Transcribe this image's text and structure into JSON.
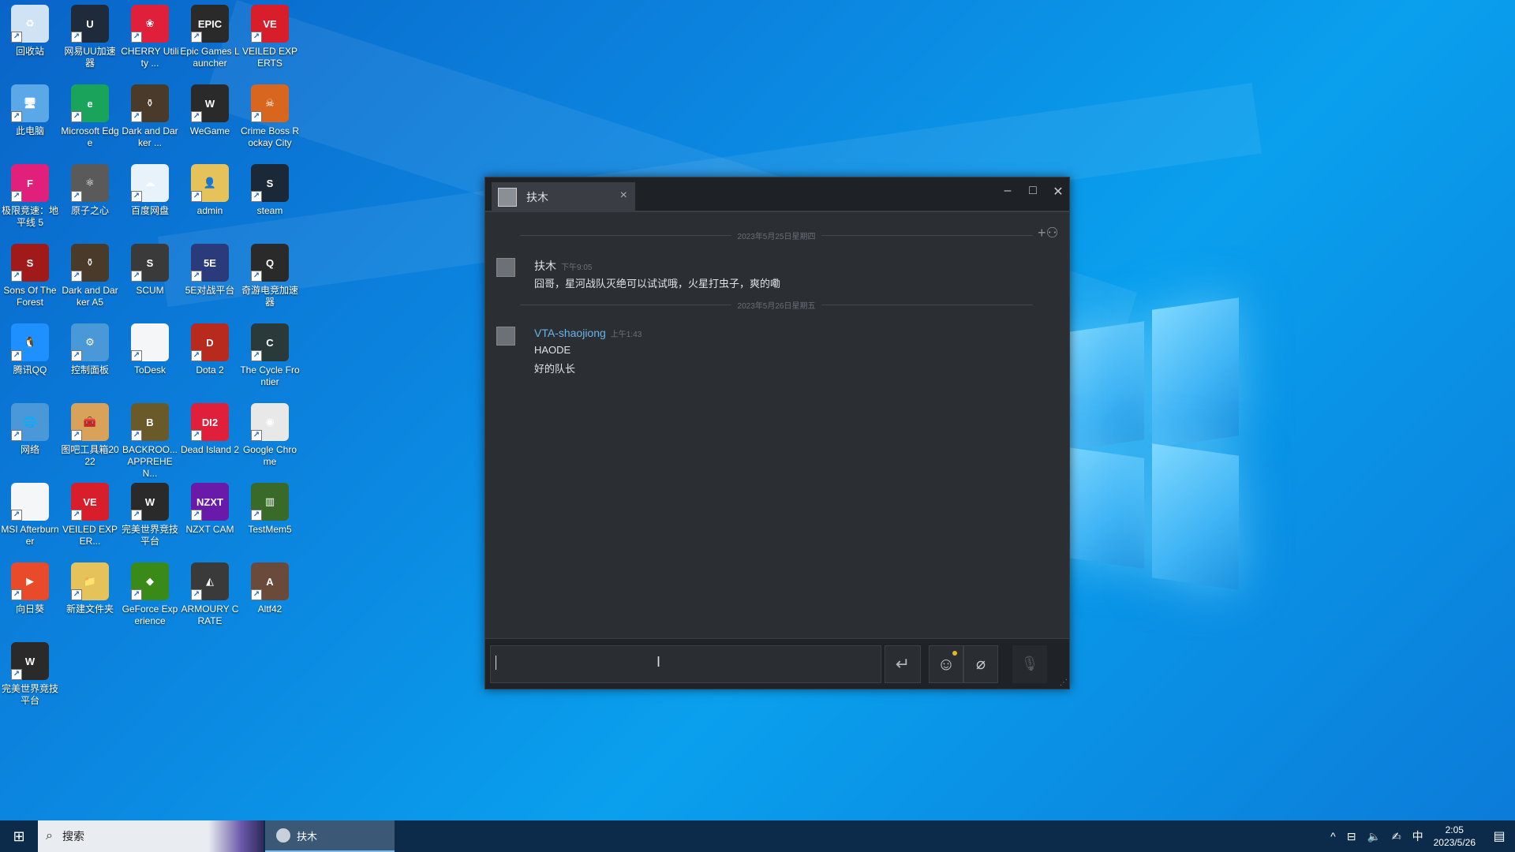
{
  "desktop": {
    "icons": [
      {
        "label": "回收站",
        "glyph": "♻",
        "color": "#cfe3f5",
        "icon": "recycle-bin-icon"
      },
      {
        "label": "网易UU加速器",
        "glyph": "U",
        "color": "#1f2a3a",
        "icon": "uu-accelerator-icon"
      },
      {
        "label": "CHERRY Utility ...",
        "glyph": "❀",
        "color": "#e0203a",
        "icon": "cherry-utility-icon"
      },
      {
        "label": "Epic Games Launcher",
        "glyph": "EPIC",
        "color": "#2a2a2a",
        "icon": "epic-games-icon"
      },
      {
        "label": "VEILED EXPERTS",
        "glyph": "VE",
        "color": "#d81e2a",
        "icon": "veiled-experts-icon"
      },
      {
        "label": "此电脑",
        "glyph": "🖥",
        "color": "#5aa8e8",
        "icon": "this-pc-icon"
      },
      {
        "label": "Microsoft Edge",
        "glyph": "e",
        "color": "#1aa35a",
        "icon": "edge-icon"
      },
      {
        "label": "Dark and Darker ...",
        "glyph": "⚱",
        "color": "#4a3a2a",
        "icon": "dark-and-darker-icon"
      },
      {
        "label": "WeGame",
        "glyph": "W",
        "color": "#2a2a2a",
        "icon": "wegame-icon"
      },
      {
        "label": "Crime Boss Rockay City",
        "glyph": "☠",
        "color": "#d8661e",
        "icon": "crime-boss-icon"
      },
      {
        "label": "极限竞速：地平线 5",
        "glyph": "F",
        "color": "#e0207a",
        "icon": "forza-horizon-icon"
      },
      {
        "label": "原子之心",
        "glyph": "⚛",
        "color": "#5a5a5a",
        "icon": "atomic-heart-icon"
      },
      {
        "label": "百度网盘",
        "glyph": "☁",
        "color": "#e8f2fb",
        "icon": "baidu-netdisk-icon"
      },
      {
        "label": "admin",
        "glyph": "👤",
        "color": "#e6c25a",
        "icon": "user-folder-icon"
      },
      {
        "label": "steam",
        "glyph": "S",
        "color": "#1b2838",
        "icon": "steam-icon"
      },
      {
        "label": "Sons Of The Forest",
        "glyph": "S",
        "color": "#a01a1a",
        "icon": "sons-of-the-forest-icon"
      },
      {
        "label": "Dark and Darker A5",
        "glyph": "⚱",
        "color": "#4a3a2a",
        "icon": "dark-and-darker-a5-icon"
      },
      {
        "label": "SCUM",
        "glyph": "S",
        "color": "#3a3a3a",
        "icon": "scum-icon"
      },
      {
        "label": "5E对战平台",
        "glyph": "5E",
        "color": "#2a3a7a",
        "icon": "5e-platform-icon"
      },
      {
        "label": "奇游电竞加速器",
        "glyph": "Q",
        "color": "#2a2a2a",
        "icon": "qiyou-accelerator-icon"
      },
      {
        "label": "腾讯QQ",
        "glyph": "🐧",
        "color": "#1e90ff",
        "icon": "qq-icon"
      },
      {
        "label": "控制面板",
        "glyph": "⚙",
        "color": "#4a98d8",
        "icon": "control-panel-icon"
      },
      {
        "label": "ToDesk",
        "glyph": "",
        "color": "#f4f6f8",
        "icon": "todesk-icon"
      },
      {
        "label": "Dota 2",
        "glyph": "D",
        "color": "#b82a1e",
        "icon": "dota2-icon"
      },
      {
        "label": "The Cycle Frontier",
        "glyph": "C",
        "color": "#2a3a3a",
        "icon": "cycle-frontier-icon"
      },
      {
        "label": "网络",
        "glyph": "🌐",
        "color": "#4a98d8",
        "icon": "network-icon"
      },
      {
        "label": "图吧工具箱2022",
        "glyph": "🧰",
        "color": "#d8a25a",
        "icon": "toolbox-icon"
      },
      {
        "label": "BACKROO... APPREHEN...",
        "glyph": "B",
        "color": "#6a5a2a",
        "icon": "backrooms-icon"
      },
      {
        "label": "Dead Island 2",
        "glyph": "DI2",
        "color": "#e0203a",
        "icon": "dead-island-icon"
      },
      {
        "label": "Google Chrome",
        "glyph": "◉",
        "color": "#e8e8e8",
        "icon": "chrome-icon"
      },
      {
        "label": "MSI Afterburner",
        "glyph": "",
        "color": "#f4f6f8",
        "icon": "msi-afterburner-icon"
      },
      {
        "label": "VEILED EXPER...",
        "glyph": "VE",
        "color": "#d81e2a",
        "icon": "veiled-experts-2-icon"
      },
      {
        "label": "完美世界竞技平台",
        "glyph": "W",
        "color": "#2a2a2a",
        "icon": "perfect-world-icon"
      },
      {
        "label": "NZXT CAM",
        "glyph": "NZXT",
        "color": "#6a1aa8",
        "icon": "nzxt-cam-icon"
      },
      {
        "label": "TestMem5",
        "glyph": "▥",
        "color": "#3a6a2a",
        "icon": "testmem5-icon"
      },
      {
        "label": "向日葵",
        "glyph": "▶",
        "color": "#e84a2a",
        "icon": "sunflower-icon"
      },
      {
        "label": "新建文件夹",
        "glyph": "📁",
        "color": "#e6c25a",
        "icon": "new-folder-icon"
      },
      {
        "label": "GeForce Experience",
        "glyph": "◆",
        "color": "#3a8a1a",
        "icon": "geforce-icon"
      },
      {
        "label": "ARMOURY CRATE",
        "glyph": "◭",
        "color": "#3a3a3a",
        "icon": "armoury-crate-icon"
      },
      {
        "label": "Altf42",
        "glyph": "A",
        "color": "#6a4a3a",
        "icon": "altf42-icon"
      },
      {
        "label": "完美世界竞技平台",
        "glyph": "W",
        "color": "#2a2a2a",
        "icon": "perfect-world-2-icon"
      }
    ]
  },
  "chat": {
    "tab_name": "扶木",
    "tab_close": "×",
    "minimize": "–",
    "maximize": "□",
    "close": "✕",
    "date1": "2023年5月25日星期四",
    "date2": "2023年5月26日星期五",
    "messages": [
      {
        "sender": "扶木",
        "time": "下午9:05",
        "lines": [
          "囧哥，星河战队灭绝可以试试哦，火星打虫子，爽的嘞"
        ],
        "name_color": "#dfe3e6"
      },
      {
        "sender": "VTA-shaojiong",
        "time": "上午1:43",
        "lines": [
          "HAODE",
          "好的队长"
        ],
        "name_color": "#6ab4e6"
      }
    ],
    "send_icon": "↵",
    "emoji_icon": "☺",
    "attach_icon": "⌀",
    "mic_icon": "🎙",
    "add_friend_icon": "+⚇"
  },
  "taskbar": {
    "search_placeholder": "搜索",
    "active_window": "扶木",
    "tray_items": [
      "^",
      "⊟",
      "🔈",
      "✍",
      "中"
    ],
    "time": "2:05",
    "date": "2023/5/26"
  }
}
